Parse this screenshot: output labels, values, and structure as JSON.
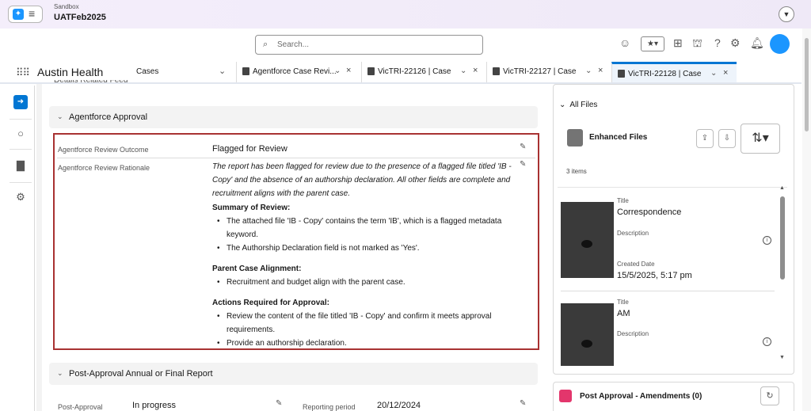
{
  "topbar": {
    "sandbox_label": "Sandbox",
    "org_name": "UATFeb2025"
  },
  "header": {
    "search_placeholder": "Search..."
  },
  "nav": {
    "app_name": "Austin Health",
    "object_selector": "Cases",
    "tabs": [
      {
        "label": "Agentforce Case Revi..."
      },
      {
        "label": "VicTRI-22126 | Case"
      },
      {
        "label": "VicTRI-22127 | Case"
      },
      {
        "label": "VicTRI-22128 | Case",
        "active": true
      }
    ]
  },
  "colors": {
    "brand_blue": "#0176d3",
    "highlight_border": "#a83232",
    "avatar": "#1b96ff"
  },
  "main": {
    "subtabs_label": "Details  Related  Feed",
    "approval_section": {
      "title": "Agentforce Approval",
      "outcome_label": "Agentforce Review Outcome",
      "outcome_value": "Flagged for Review",
      "rationale_label": "Agentforce Review Rationale",
      "rationale": {
        "intro": "The report has been flagged for review due to the presence of a flagged file titled 'IB - Copy' and the absence of an authorship declaration. All other fields are complete and recruitment aligns with the parent case.",
        "summary_heading": "Summary of Review:",
        "summary_items": [
          "The attached file 'IB - Copy' contains the term 'IB', which is a flagged metadata keyword.",
          "The Authorship Declaration field is not marked as 'Yes'."
        ],
        "alignment_heading": "Parent Case Alignment:",
        "alignment_items": [
          "Recruitment and budget align with the parent case."
        ],
        "actions_heading": "Actions Required for Approval:",
        "actions_items": [
          "Review the content of the file titled 'IB - Copy' and confirm it meets approval requirements.",
          "Provide an authorship declaration."
        ]
      }
    },
    "post_approval_section": {
      "title": "Post-Approval Annual or Final Report",
      "field1_label": "Post-Approval",
      "field1_value": "In progress",
      "field2_label": "Reporting period",
      "field2_value": "20/12/2024"
    }
  },
  "right": {
    "all_files": "All Files",
    "enhanced_files_title": "Enhanced Files",
    "item_count": "3 items",
    "files": [
      {
        "title_label": "Title",
        "title": "Correspondence",
        "desc_label": "Description",
        "created_label": "Created Date",
        "created": "15/5/2025, 5:17 pm"
      },
      {
        "title_label": "Title",
        "title": "AM",
        "desc_label": "Description"
      }
    ],
    "amendments_title": "Post Approval - Amendments (0)"
  }
}
